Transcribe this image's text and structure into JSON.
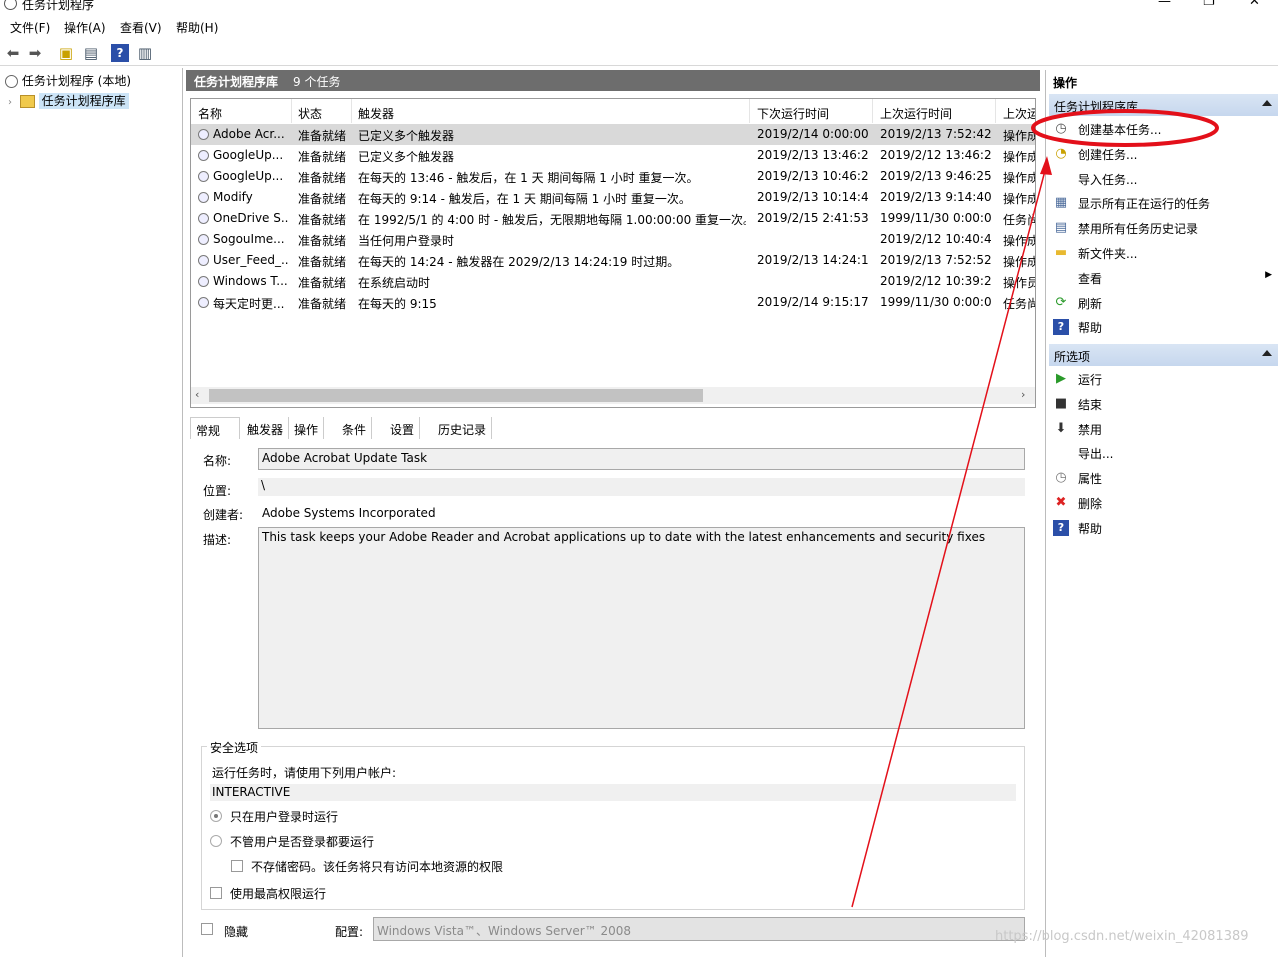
{
  "window": {
    "title": "任务计划程序"
  },
  "menu": [
    "文件(F)",
    "操作(A)",
    "查看(V)",
    "帮助(H)"
  ],
  "tree": {
    "root": "任务计划程序 (本地)",
    "library": "任务计划程序库"
  },
  "center": {
    "title": "任务计划程序库",
    "count": "9 个任务"
  },
  "columns": [
    "名称",
    "状态",
    "触发器",
    "下次运行时间",
    "上次运行时间",
    "上次运"
  ],
  "tasks": [
    {
      "name": "Adobe Acr...",
      "status": "准备就绪",
      "trigger": "已定义多个触发器",
      "next": "2019/2/14 0:00:00",
      "last": "2019/2/13 7:52:42",
      "result": "操作成"
    },
    {
      "name": "GoogleUp...",
      "status": "准备就绪",
      "trigger": "已定义多个触发器",
      "next": "2019/2/13 13:46:24",
      "last": "2019/2/12 13:46:24",
      "result": "操作成"
    },
    {
      "name": "GoogleUp...",
      "status": "准备就绪",
      "trigger": "在每天的 13:46 - 触发后，在 1 天 期间每隔 1 小时 重复一次。",
      "next": "2019/2/13 10:46:24",
      "last": "2019/2/13 9:46:25",
      "result": "操作成"
    },
    {
      "name": "Modify",
      "status": "准备就绪",
      "trigger": "在每天的 9:14 - 触发后，在 1 天 期间每隔 1 小时 重复一次。",
      "next": "2019/2/13 10:14:40",
      "last": "2019/2/13 9:14:40",
      "result": "操作成"
    },
    {
      "name": "OneDrive S...",
      "status": "准备就绪",
      "trigger": "在 1992/5/1 的 4:00 时 - 触发后，无限期地每隔 1.00:00:00 重复一次。",
      "next": "2019/2/15 2:41:53",
      "last": "1999/11/30 0:00:00",
      "result": "任务尚"
    },
    {
      "name": "SogouIme...",
      "status": "准备就绪",
      "trigger": "当任何用户登录时",
      "next": "",
      "last": "2019/2/12 10:40:42",
      "result": "操作成"
    },
    {
      "name": "User_Feed_...",
      "status": "准备就绪",
      "trigger": "在每天的 14:24 - 触发器在 2029/2/13 14:24:19 时过期。",
      "next": "2019/2/13 14:24:19",
      "last": "2019/2/13 7:52:52",
      "result": "操作成"
    },
    {
      "name": "Windows T...",
      "status": "准备就绪",
      "trigger": "在系统启动时",
      "next": "",
      "last": "2019/2/12 10:39:24",
      "result": "操作员"
    },
    {
      "name": "每天定时更...",
      "status": "准备就绪",
      "trigger": "在每天的 9:15",
      "next": "2019/2/14 9:15:17",
      "last": "1999/11/30 0:00:00",
      "result": "任务尚"
    }
  ],
  "tabs": [
    "常规",
    "触发器",
    "操作",
    "条件",
    "设置",
    "历史记录"
  ],
  "general": {
    "name_label": "名称:",
    "name_value": "Adobe Acrobat Update Task",
    "location_label": "位置:",
    "location_value": "\\",
    "author_label": "创建者:",
    "author_value": "Adobe Systems Incorporated",
    "desc_label": "描述:",
    "desc_value": "This task keeps your Adobe Reader and Acrobat applications up to date with the latest enhancements and security fixes"
  },
  "security": {
    "legend": "安全选项",
    "run_as_label": "运行任务时，请使用下列用户帐户:",
    "account": "INTERACTIVE",
    "opt_logged_on": "只在用户登录时运行",
    "opt_whether": "不管用户是否登录都要运行",
    "opt_no_store": "不存储密码。该任务将只有访问本地资源的权限",
    "opt_highest": "使用最高权限运行"
  },
  "footer": {
    "hidden_label": "隐藏",
    "config_label": "配置:",
    "config_value": "Windows Vista™、Windows Server™ 2008"
  },
  "actions": {
    "title": "操作",
    "section1": "任务计划程序库",
    "items1": [
      {
        "label": "创建基本任务...",
        "icon": "create-basic-task-icon"
      },
      {
        "label": "创建任务...",
        "icon": "create-task-icon"
      },
      {
        "label": "导入任务...",
        "icon": "import-icon"
      },
      {
        "label": "显示所有正在运行的任务",
        "icon": "running-tasks-icon"
      },
      {
        "label": "禁用所有任务历史记录",
        "icon": "history-icon"
      },
      {
        "label": "新文件夹...",
        "icon": "folder-icon"
      },
      {
        "label": "查看",
        "icon": "view-icon"
      },
      {
        "label": "刷新",
        "icon": "refresh-icon"
      },
      {
        "label": "帮助",
        "icon": "help-icon"
      }
    ],
    "section2": "所选项",
    "items2": [
      {
        "label": "运行",
        "icon": "run-icon"
      },
      {
        "label": "结束",
        "icon": "stop-icon"
      },
      {
        "label": "禁用",
        "icon": "disable-icon"
      },
      {
        "label": "导出...",
        "icon": "export-icon"
      },
      {
        "label": "属性",
        "icon": "properties-icon"
      },
      {
        "label": "删除",
        "icon": "delete-icon"
      },
      {
        "label": "帮助",
        "icon": "help-icon"
      }
    ]
  },
  "colors": {
    "annotation": "#e3101a",
    "selected_row": "#d9d9d9",
    "header_bar": "#6d6d6d",
    "section_header": "#c6d7ee"
  },
  "watermark": "https://blog.csdn.net/weixin_42081389"
}
